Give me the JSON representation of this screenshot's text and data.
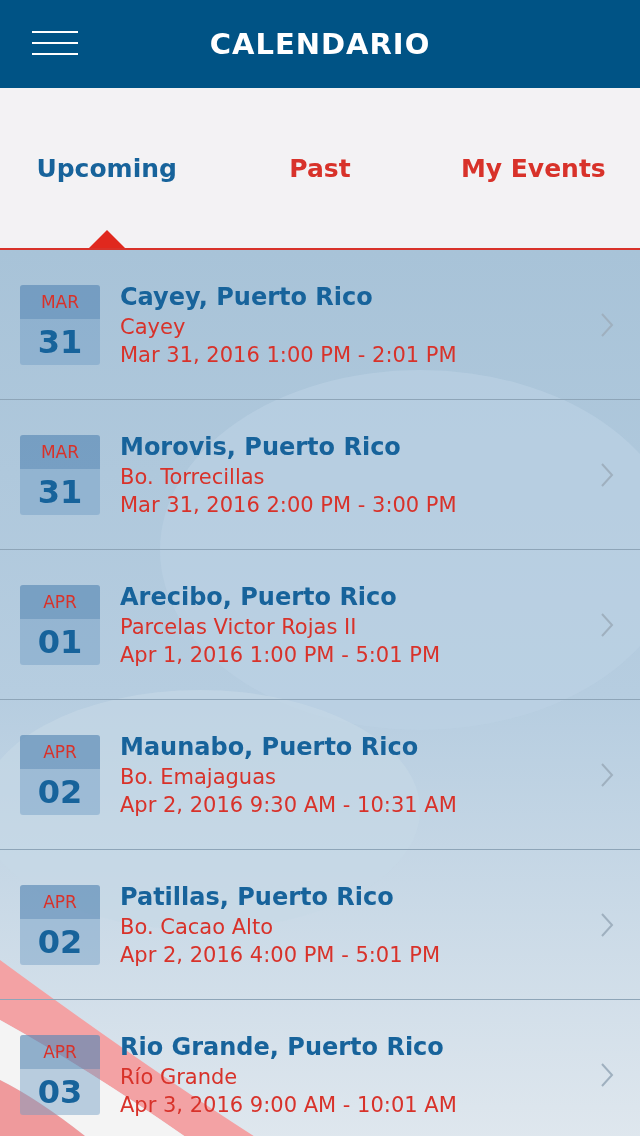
{
  "header": {
    "title": "CALENDARIO"
  },
  "tabs": [
    {
      "label": "Upcoming",
      "selected": true
    },
    {
      "label": "Past",
      "selected": false
    },
    {
      "label": "My Events",
      "selected": false
    }
  ],
  "events": [
    {
      "month": "MAR",
      "day": "31",
      "title": "Cayey, Puerto Rico",
      "place": "Cayey",
      "time": "Mar 31, 2016 1:00 PM - 2:01 PM"
    },
    {
      "month": "MAR",
      "day": "31",
      "title": "Morovis, Puerto Rico",
      "place": "Bo. Torrecillas",
      "time": "Mar 31, 2016 2:00 PM - 3:00 PM"
    },
    {
      "month": "APR",
      "day": "01",
      "title": "Arecibo, Puerto Rico",
      "place": "Parcelas Victor Rojas II",
      "time": "Apr 1, 2016 1:00 PM - 5:01 PM"
    },
    {
      "month": "APR",
      "day": "02",
      "title": "Maunabo, Puerto Rico",
      "place": "Bo. Emajaguas",
      "time": "Apr 2, 2016 9:30 AM - 10:31 AM"
    },
    {
      "month": "APR",
      "day": "02",
      "title": "Patillas, Puerto Rico",
      "place": "Bo. Cacao Alto",
      "time": "Apr 2, 2016 4:00 PM - 5:01 PM"
    },
    {
      "month": "APR",
      "day": "03",
      "title": "Rio Grande, Puerto Rico",
      "place": "Río Grande",
      "time": "Apr 3, 2016 9:00 AM - 10:01 AM"
    }
  ]
}
